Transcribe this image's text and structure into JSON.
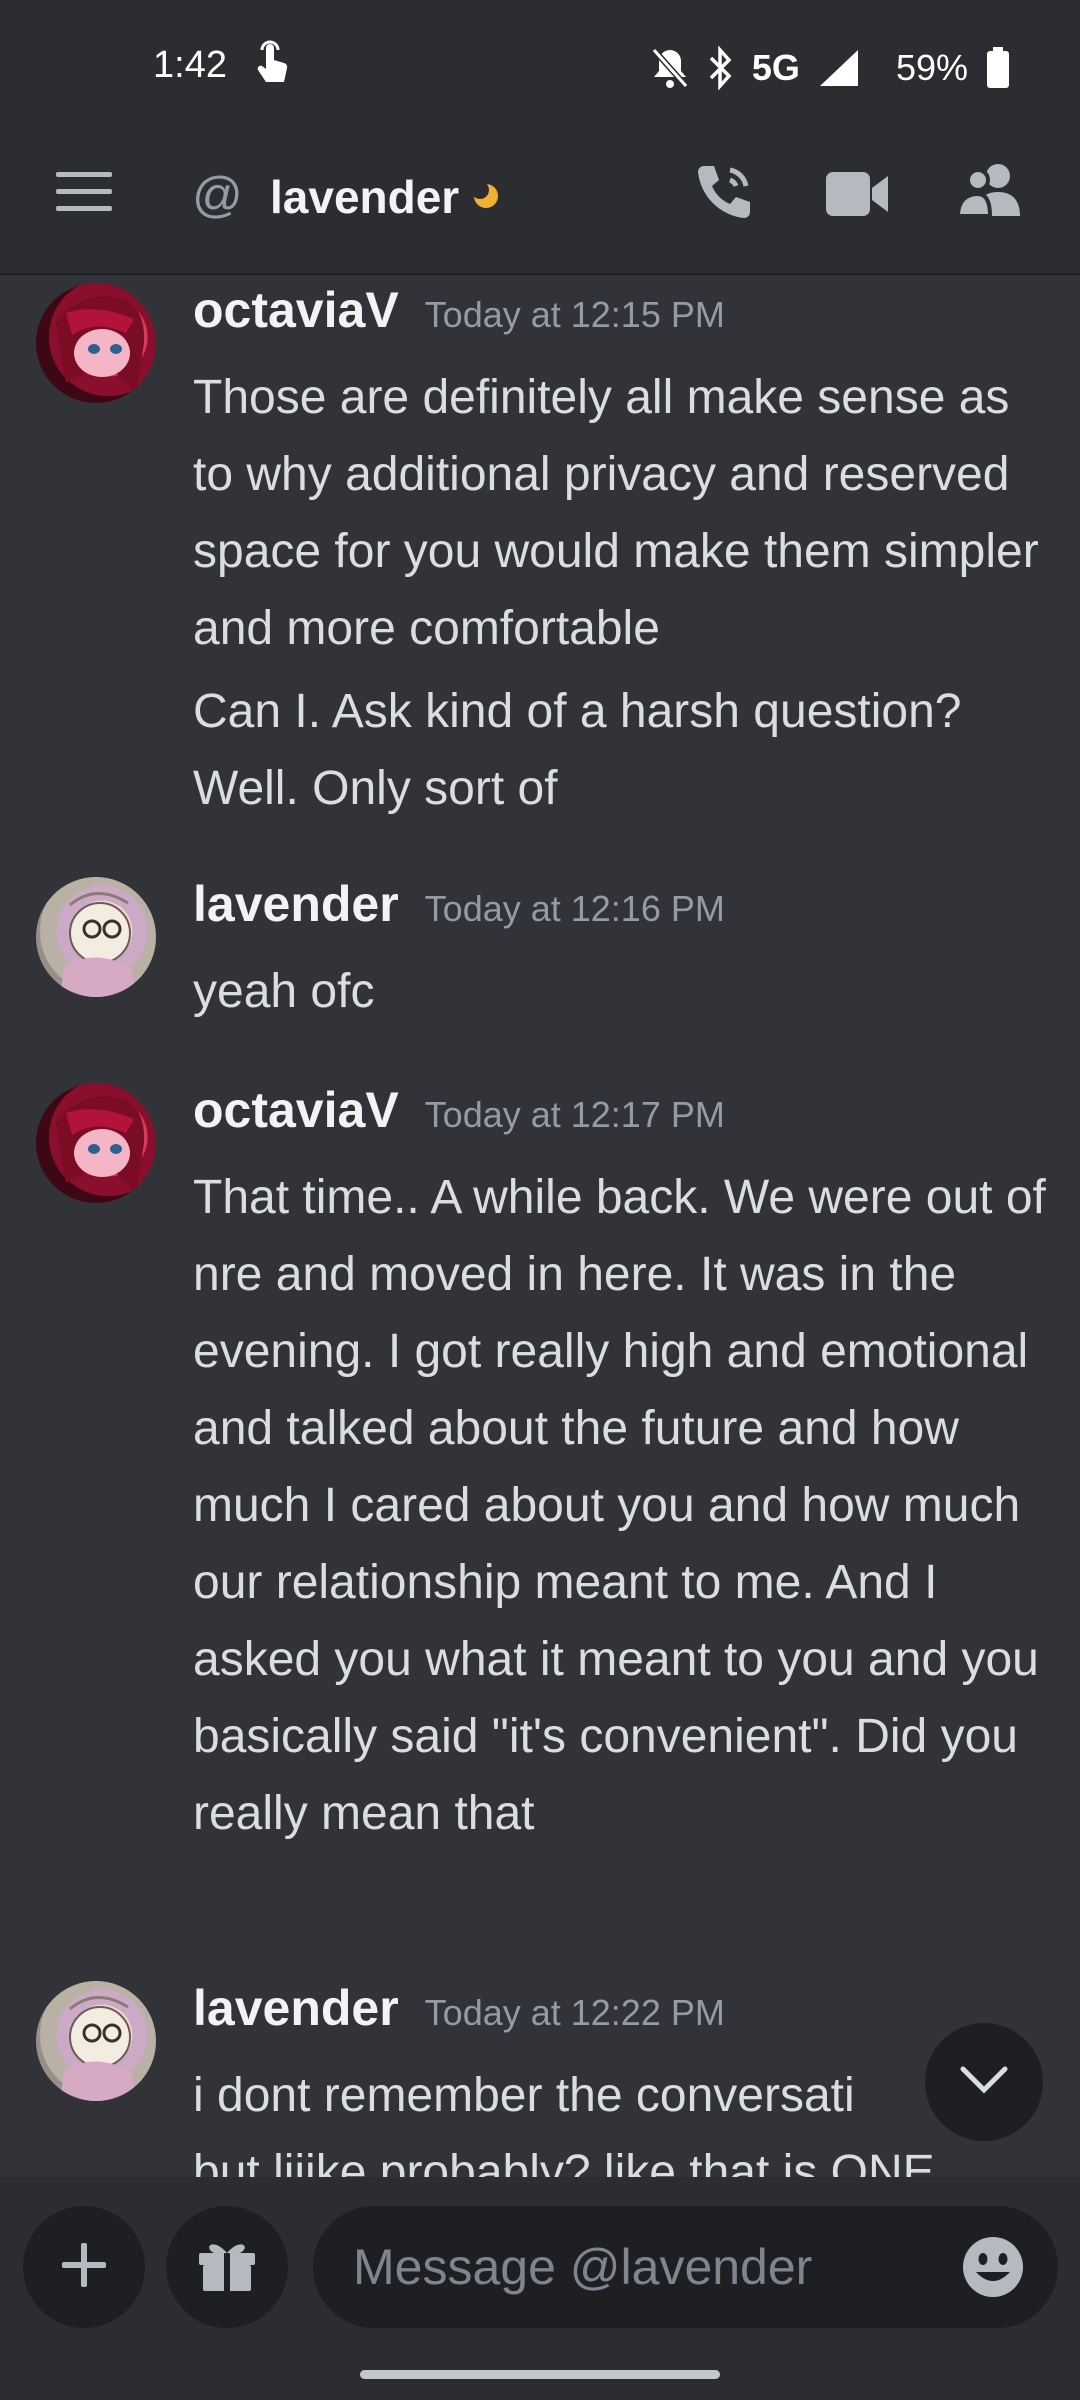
{
  "status_bar": {
    "time": "1:42",
    "network": "5G",
    "battery": "59%"
  },
  "header": {
    "channel_name": "lavender",
    "status": "idle"
  },
  "messages": [
    {
      "username": "octaviaV",
      "timestamp": "Today at 12:15 PM",
      "lines": [
        "Those are definitely all make sense as to why additional privacy and reserved space for you would make them simpler and more comfortable",
        "Can I. Ask kind of a harsh question? Well. Only sort of"
      ]
    },
    {
      "username": "lavender",
      "timestamp": "Today at 12:16 PM",
      "lines": [
        "yeah ofc"
      ]
    },
    {
      "username": "octaviaV",
      "timestamp": "Today at 12:17 PM",
      "lines": [
        "That time.. A while back. We were out of nre and moved in here. It was in the evening. I got really high and emotional and talked about the future and how much I cared about you and how much our relationship meant to me. And I asked you what it meant to you and you basically said \"it's convenient\". Did you really mean that"
      ]
    },
    {
      "username": "lavender",
      "timestamp": "Today at 12:22 PM",
      "lines": [
        "i dont remember the conversati",
        "but liiike probably? like that is ONE"
      ]
    }
  ],
  "composer": {
    "placeholder": "Message @lavender"
  },
  "colors": {
    "background": "#313338",
    "header": "#2b2d31",
    "idle": "#f0b232"
  },
  "icons": {
    "menu": "hamburger-menu-icon",
    "at": "at-sign-icon",
    "call": "phone-call-icon",
    "video": "video-camera-icon",
    "members": "members-icon",
    "add": "plus-icon",
    "gift": "gift-icon",
    "emoji": "emoji-smile-icon",
    "scroll": "chevron-down-icon"
  }
}
